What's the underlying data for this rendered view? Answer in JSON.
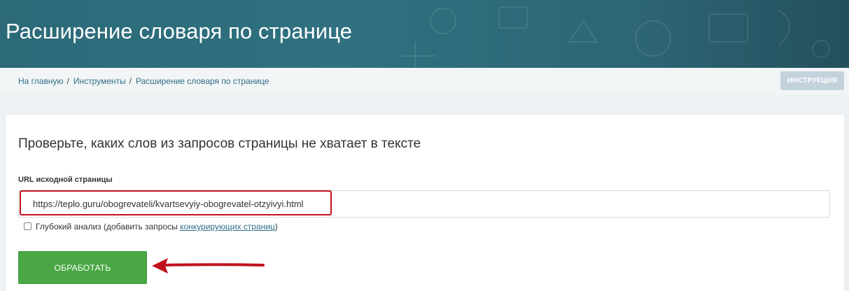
{
  "page": {
    "title": "Расширение словаря по странице"
  },
  "breadcrumbs": {
    "items": [
      "На главную",
      "Инструменты",
      "Расширение словаря по странице"
    ],
    "separator": "/"
  },
  "header": {
    "instruction_label": "ИНСТРУКЦИЯ"
  },
  "form": {
    "heading": "Проверьте, каких слов из запросов страницы не хватает в тексте",
    "url_label": "URL исходной страницы",
    "url_value": "https://teplo.guru/obogrevateli/kvartsevyiy-obogrevatel-otzyivyi.html",
    "deep_analysis_label": "Глубокий анализ (добавить запросы ",
    "deep_analysis_link": "конкурирующих страниц",
    "deep_analysis_suffix": ")",
    "deep_analysis_checked": false,
    "submit_label": "ОБРАБОТАТЬ"
  },
  "colors": {
    "banner": "#2f7180",
    "link": "#2f6f88",
    "submit": "#49a744",
    "annotation": "#c0121e",
    "instruction_button": "#c3d3dc"
  },
  "annotations": {
    "highlight": "red-outline-box",
    "arrow": "red-arrow-pointing-left"
  }
}
